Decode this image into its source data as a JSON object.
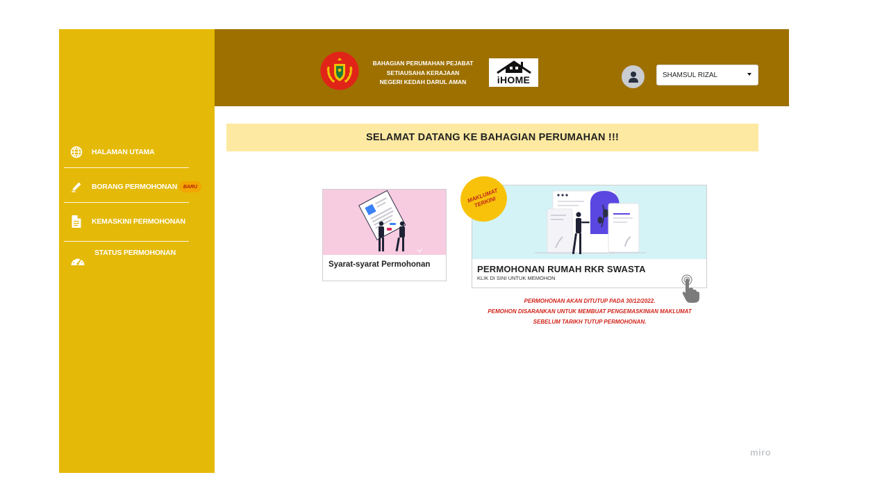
{
  "header": {
    "org_title_lines": [
      "BAHAGIAN PERUMAHAN PEJABAT",
      "SETIAUSAHA KERAJAAN",
      "NEGERI KEDAH DARUL AMAN"
    ],
    "app_logo_text": "iHOME",
    "user": {
      "selected_name": "SHAMSUL RIZAL",
      "avatar_icon": "user-icon"
    },
    "colors": {
      "background": "#9e7000"
    }
  },
  "sidebar": {
    "colors": {
      "background": "#e5b907"
    },
    "items": [
      {
        "label": "HALAMAN UTAMA",
        "icon": "globe-icon"
      },
      {
        "label": "BORANG PERMOHONAN",
        "icon": "pen-icon",
        "badge": "BARU"
      },
      {
        "label": "KEMASKINI PERMOHONAN",
        "icon": "document-icon"
      },
      {
        "label": "STATUS PERMOHONAN",
        "icon": "speedometer-icon"
      }
    ]
  },
  "main": {
    "welcome_text": "SELAMAT DATANG KE BAHAGIAN PERUMAHAN !!!",
    "cards": [
      {
        "title": "Syarat-syarat Permohonan"
      },
      {
        "title": "PERMOHONAN RUMAH RKR SWASTA",
        "subtitle": "KLIK DI SINI UNTUK MEMOHON",
        "sticker_lines": [
          "MAKLUMAT",
          "TERKINI"
        ]
      }
    ],
    "notice_lines": [
      "PERMOHONAN AKAN DITUTUP PADA 30/12/2022.",
      "PEMOHON DISARANKAN UNTUK  MEMBUAT PENGEMASKINIAN MAKLUMAT",
      "SEBELUM TARIKH TUTUP PERMOHONAN."
    ]
  },
  "watermark": "miro"
}
